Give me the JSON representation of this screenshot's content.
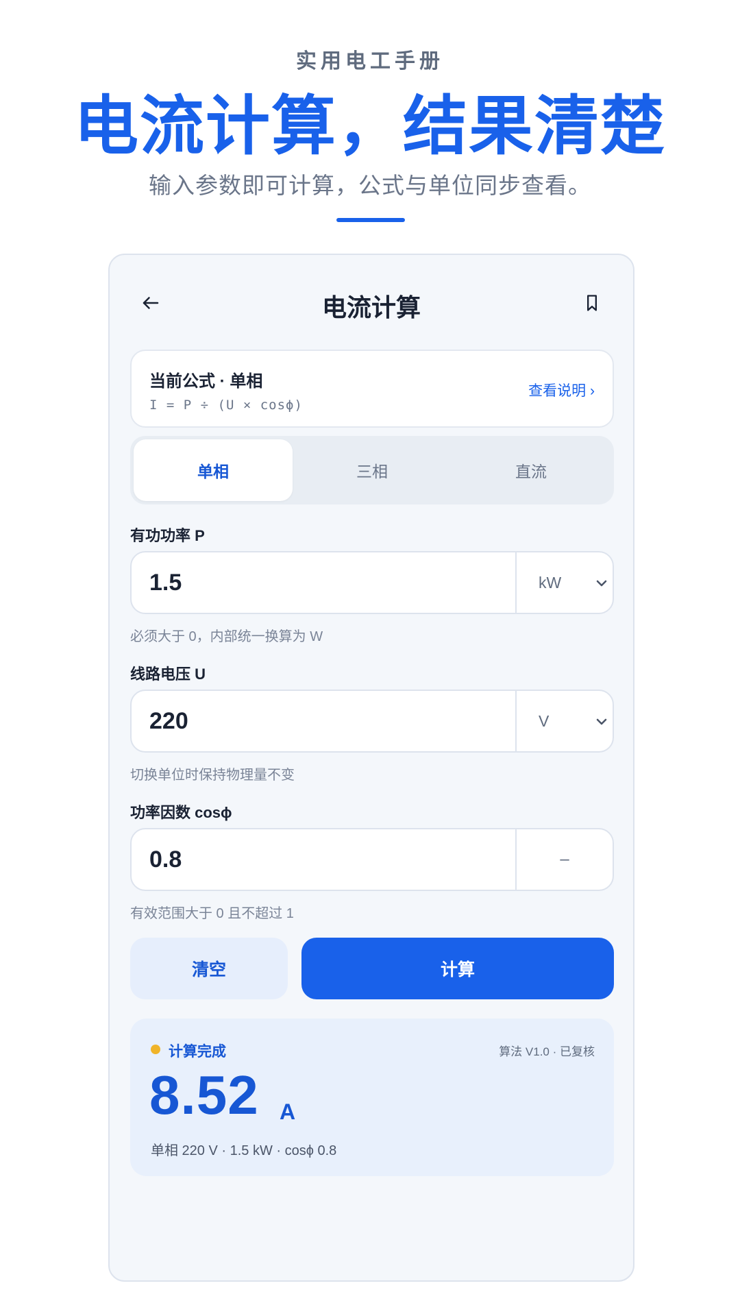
{
  "hero": {
    "eyebrow": "实用电工手册",
    "title": "电流计算，结果清楚",
    "subtitle": "输入参数即可计算，公式与单位同步查看。"
  },
  "app": {
    "title": "电流计算",
    "icons": {
      "back": "arrow-left-icon",
      "bookmark": "bookmark-icon",
      "chevron": "chevron-down-icon"
    }
  },
  "formula": {
    "title": "当前公式 · 单相",
    "expression": "I = P ÷ (U × cosϕ)",
    "link": "查看说明 ›"
  },
  "tabs": [
    {
      "label": "单相",
      "active": true
    },
    {
      "label": "三相",
      "active": false
    },
    {
      "label": "直流",
      "active": false
    }
  ],
  "fields": [
    {
      "label": "有功功率 P",
      "value": "1.5",
      "unit": "kW",
      "hint": "必须大于 0，内部统一换算为 W"
    },
    {
      "label": "线路电压 U",
      "value": "220",
      "unit": "V",
      "hint": "切换单位时保持物理量不变"
    },
    {
      "label": "功率因数 cosϕ",
      "value": "0.8",
      "unit": "–",
      "hint": "有效范围大于 0 且不超过 1"
    }
  ],
  "actions": {
    "clear": "清空",
    "calculate": "计算"
  },
  "result": {
    "status": "计算完成",
    "algorithm": "算法 V1.0 · 已复核",
    "value": "8.52",
    "unit": "A",
    "detail": "单相 220 V · 1.5 kW · cosϕ 0.8"
  },
  "colors": {
    "accent": "#1961ea",
    "status_dot": "#f0b429",
    "card_bg": "#f4f7fb",
    "result_bg": "#e8f0fc"
  }
}
